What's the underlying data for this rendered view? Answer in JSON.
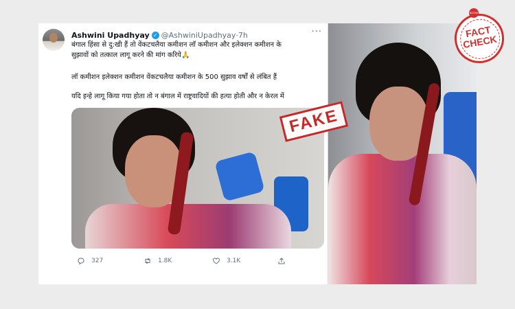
{
  "tweet": {
    "author_name": "Ashwini Upadhyay",
    "handle": "@AshwiniUpadhyay",
    "separator": " · ",
    "time": "7h",
    "more": "···",
    "text_line1": "बंगाल हिंसा से दु:खी हैं तो वेंकटचलैया कमीशन लॉ कमीशन और इलेक्शन कमीशन के",
    "text_line2": "सुझावों को तत्काल लागू करने की मांग करिये",
    "emoji": "🙏",
    "text_line3": "लॉ कमीशन इलेक्शन कमीशन वेंकटचलैया कमीशन के 500 सुझाव वर्षों से लंबित हैं",
    "text_line4": "यदि इन्हे लागू किया गया होता तो न बंगाल में राष्ट्रवादियों की हत्या होती और न केरल में",
    "actions": {
      "reply_count": "327",
      "retweet_count": "1.8K",
      "like_count": "3.1K"
    }
  },
  "stamp": {
    "label": "FAKE"
  },
  "badge": {
    "brand": "BOOM",
    "line1": "FACT",
    "line2": "CHECK"
  },
  "icons": [
    "verified-icon",
    "more-icon",
    "reply-icon",
    "retweet-icon",
    "like-icon",
    "share-icon"
  ],
  "colors": {
    "accent": "#1d9bf0",
    "stamp": "#c62828",
    "text": "#0f1419",
    "muted": "#5b7083"
  }
}
